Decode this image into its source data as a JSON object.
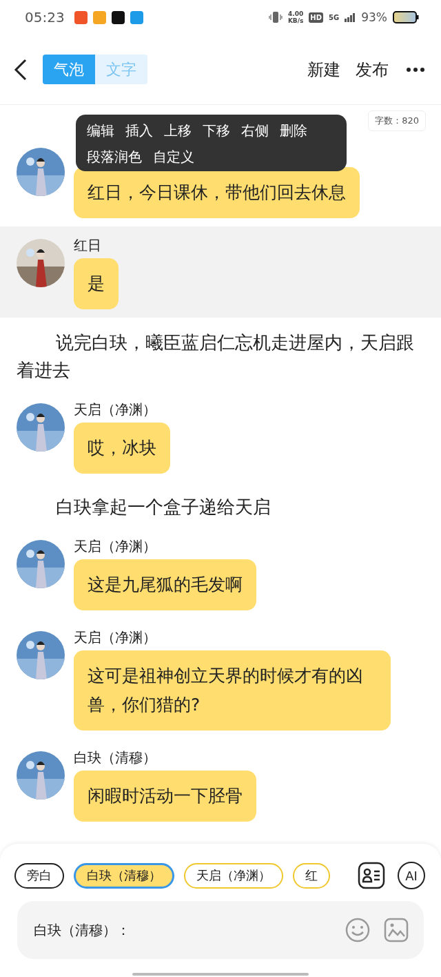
{
  "status_bar": {
    "time": "05:23",
    "apps": [
      {
        "color": "#f0552a"
      },
      {
        "color": "#f5a623"
      },
      {
        "color": "#111111"
      },
      {
        "color": "#1e9be8"
      }
    ],
    "speed": "4.00",
    "speed_unit": "KB/s",
    "hd": "HD",
    "network": "5G",
    "battery": "93%"
  },
  "header": {
    "tabs": [
      {
        "label": "气泡",
        "selected": true
      },
      {
        "label": "文字",
        "selected": false
      }
    ],
    "actions": [
      "新建",
      "发布"
    ]
  },
  "word_count": "字数：820",
  "context_menu": {
    "items": [
      "编辑",
      "插入",
      "上移",
      "下移",
      "右侧",
      "删除",
      "段落润色",
      "自定义"
    ]
  },
  "items": [
    {
      "kind": "message",
      "text": "红日，今日课休，带他们回去休息",
      "highlighted": false
    },
    {
      "kind": "message",
      "speaker": "红日",
      "text": "是",
      "highlighted": true
    },
    {
      "kind": "narration",
      "text": "说完白玦，曦臣蓝启仁忘机走进屋内，天启跟着进去"
    },
    {
      "kind": "message",
      "speaker": "天启（净渊）",
      "text": "哎，冰块",
      "highlighted": false
    },
    {
      "kind": "narration",
      "text": "白玦拿起一个盒子递给天启"
    },
    {
      "kind": "message",
      "speaker": "天启（净渊）",
      "text": "这是九尾狐的毛发啊",
      "highlighted": false
    },
    {
      "kind": "message",
      "speaker": "天启（净渊）",
      "text": "这可是祖神创立天界的时候才有的凶兽，你们猎的?",
      "highlighted": false
    },
    {
      "kind": "message",
      "speaker": "白玦（清穆）",
      "text": "闲暇时活动一下胫骨",
      "highlighted": false
    }
  ],
  "roles": [
    {
      "label": "旁白",
      "kind": "narrator",
      "selected": false
    },
    {
      "label": "白玦（清穆）",
      "kind": "character",
      "selected": true
    },
    {
      "label": "天启（净渊）",
      "kind": "character",
      "selected": false
    },
    {
      "label": "红",
      "kind": "character",
      "selected": false
    }
  ],
  "ai_button": "AI",
  "input": {
    "value": "白玦（清穆）："
  }
}
